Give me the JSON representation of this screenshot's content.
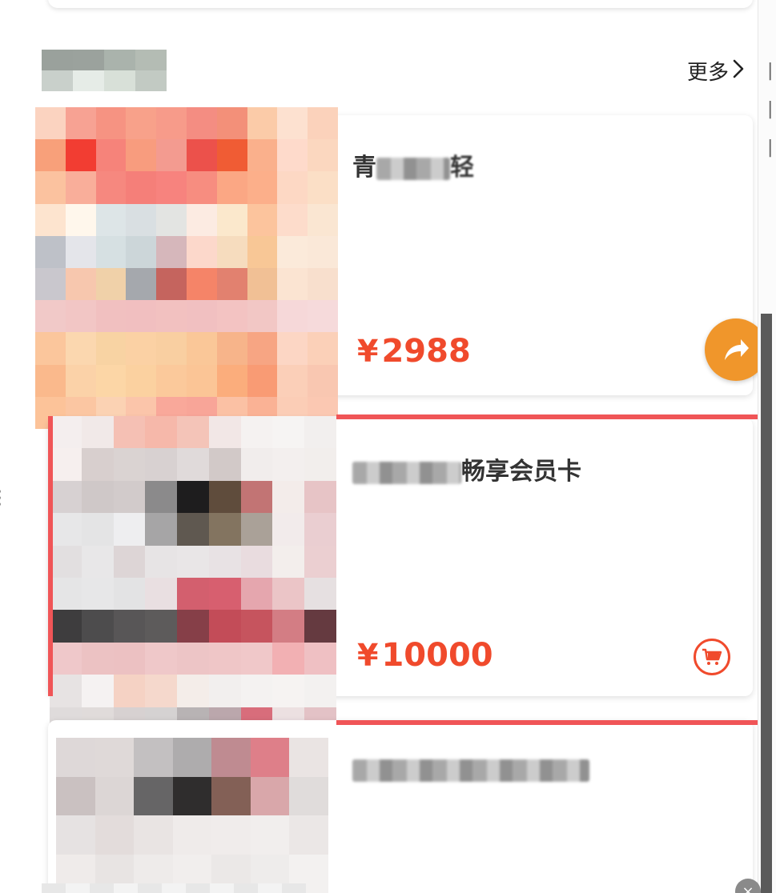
{
  "header": {
    "more_label": "更多",
    "more_icon": "chevron-right-icon"
  },
  "products": [
    {
      "title_prefix": "青",
      "title_suffix": "轻",
      "price_symbol": "¥",
      "price": "2988",
      "cart_icon": "cart-icon"
    },
    {
      "title_suffix": "畅享会员卡",
      "price_symbol": "¥",
      "price": "10000",
      "cart_icon": "cart-icon"
    },
    {
      "title_suffix": ""
    }
  ],
  "fab": {
    "icon": "share-arrow-icon"
  },
  "colors": {
    "price": "#f04a2c",
    "highlight_border": "#f05557",
    "fab": "#f0962b",
    "title": "#333333"
  }
}
